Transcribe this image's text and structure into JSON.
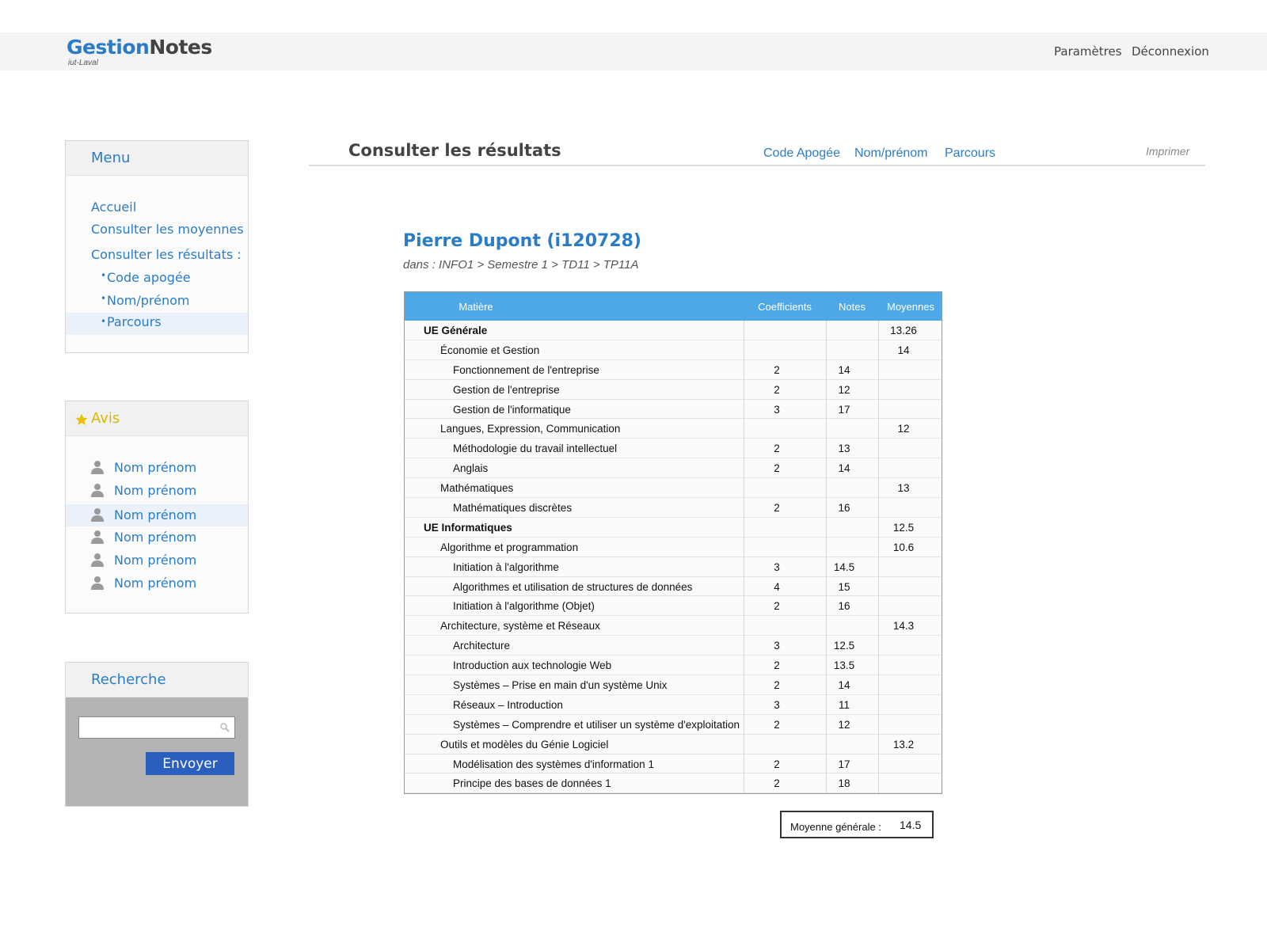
{
  "header": {
    "logo_part1": "Gestion",
    "logo_part2": "Notes",
    "logo_sub": "iut-Laval",
    "links": [
      "Paramètres",
      "Déconnexion"
    ]
  },
  "menu": {
    "title": "Menu",
    "items": [
      "Accueil",
      "Consulter les moyennes",
      "Consulter les résultats :"
    ],
    "subitems": [
      "Code apogée",
      "Nom/prénom",
      "Parcours"
    ],
    "active_subitem": "Parcours"
  },
  "avis": {
    "title": "Avis",
    "items": [
      "Nom prénom",
      "Nom prénom",
      "Nom prénom",
      "Nom prénom",
      "Nom prénom",
      "Nom prénom"
    ]
  },
  "recherche": {
    "title": "Recherche",
    "input_value": "",
    "button": "Envoyer"
  },
  "main": {
    "title": "Consulter les résultats",
    "tabs": [
      "Code Apogée",
      "Nom/prénom",
      "Parcours"
    ],
    "print": "Imprimer",
    "student_name": "Pierre Dupont (i120728)",
    "student_path": "dans : INFO1 > Semestre 1 > TD11 > TP11A"
  },
  "table": {
    "columns": [
      "Matière",
      "Coefficients",
      "Notes",
      "Moyennes"
    ],
    "rows": [
      {
        "level": 0,
        "matiere": "UE Générale",
        "coef": "",
        "note": "",
        "moyenne": "13.26"
      },
      {
        "level": 1,
        "matiere": "Économie et Gestion",
        "coef": "",
        "note": "",
        "moyenne": "14"
      },
      {
        "level": 2,
        "matiere": "Fonctionnement de l'entreprise",
        "coef": "2",
        "note": "14",
        "moyenne": ""
      },
      {
        "level": 2,
        "matiere": "Gestion de l'entreprise",
        "coef": "2",
        "note": "12",
        "moyenne": ""
      },
      {
        "level": 2,
        "matiere": "Gestion de l'informatique",
        "coef": "3",
        "note": "17",
        "moyenne": ""
      },
      {
        "level": 1,
        "matiere": "Langues, Expression, Communication",
        "coef": "",
        "note": "",
        "moyenne": "12"
      },
      {
        "level": 2,
        "matiere": "Méthodologie du travail intellectuel",
        "coef": "2",
        "note": "13",
        "moyenne": ""
      },
      {
        "level": 2,
        "matiere": "Anglais",
        "coef": "2",
        "note": "14",
        "moyenne": ""
      },
      {
        "level": 1,
        "matiere": "Mathématiques",
        "coef": "",
        "note": "",
        "moyenne": "13"
      },
      {
        "level": 2,
        "matiere": "Mathématiques discrètes",
        "coef": "2",
        "note": "16",
        "moyenne": ""
      },
      {
        "level": 0,
        "matiere": "UE Informatiques",
        "coef": "",
        "note": "",
        "moyenne": "12.5"
      },
      {
        "level": 1,
        "matiere": "Algorithme et programmation",
        "coef": "",
        "note": "",
        "moyenne": "10.6"
      },
      {
        "level": 2,
        "matiere": "Initiation à l'algorithme",
        "coef": "3",
        "note": "14.5",
        "moyenne": ""
      },
      {
        "level": 2,
        "matiere": "Algorithmes et utilisation de structures de données",
        "coef": "4",
        "note": "15",
        "moyenne": ""
      },
      {
        "level": 2,
        "matiere": "Initiation à l'algorithme (Objet)",
        "coef": "2",
        "note": "16",
        "moyenne": ""
      },
      {
        "level": 1,
        "matiere": "Architecture, système et Réseaux",
        "coef": "",
        "note": "",
        "moyenne": "14.3"
      },
      {
        "level": 2,
        "matiere": "Architecture",
        "coef": "3",
        "note": "12.5",
        "moyenne": ""
      },
      {
        "level": 2,
        "matiere": "Introduction aux technologie Web",
        "coef": "2",
        "note": "13.5",
        "moyenne": ""
      },
      {
        "level": 2,
        "matiere": "Systèmes – Prise en main d'un système Unix",
        "coef": "2",
        "note": "14",
        "moyenne": ""
      },
      {
        "level": 2,
        "matiere": "Réseaux – Introduction",
        "coef": "3",
        "note": "11",
        "moyenne": ""
      },
      {
        "level": 2,
        "matiere": "Systèmes – Comprendre et utiliser un système d'exploitation",
        "coef": "2",
        "note": "12",
        "moyenne": ""
      },
      {
        "level": 1,
        "matiere": "Outils et modèles du Génie Logiciel",
        "coef": "",
        "note": "",
        "moyenne": "13.2"
      },
      {
        "level": 2,
        "matiere": "Modélisation des systèmes d'information 1",
        "coef": "2",
        "note": "17",
        "moyenne": ""
      },
      {
        "level": 2,
        "matiere": "Principe des bases de données 1",
        "coef": "2",
        "note": "18",
        "moyenne": ""
      }
    ],
    "moyenne_generale_label": "Moyenne générale :",
    "moyenne_generale_value": "14.5"
  },
  "colors": {
    "accent": "#2a7cc7",
    "table_header": "#4ea8e8",
    "button": "#2a5fbf",
    "star": "#e6c200"
  }
}
